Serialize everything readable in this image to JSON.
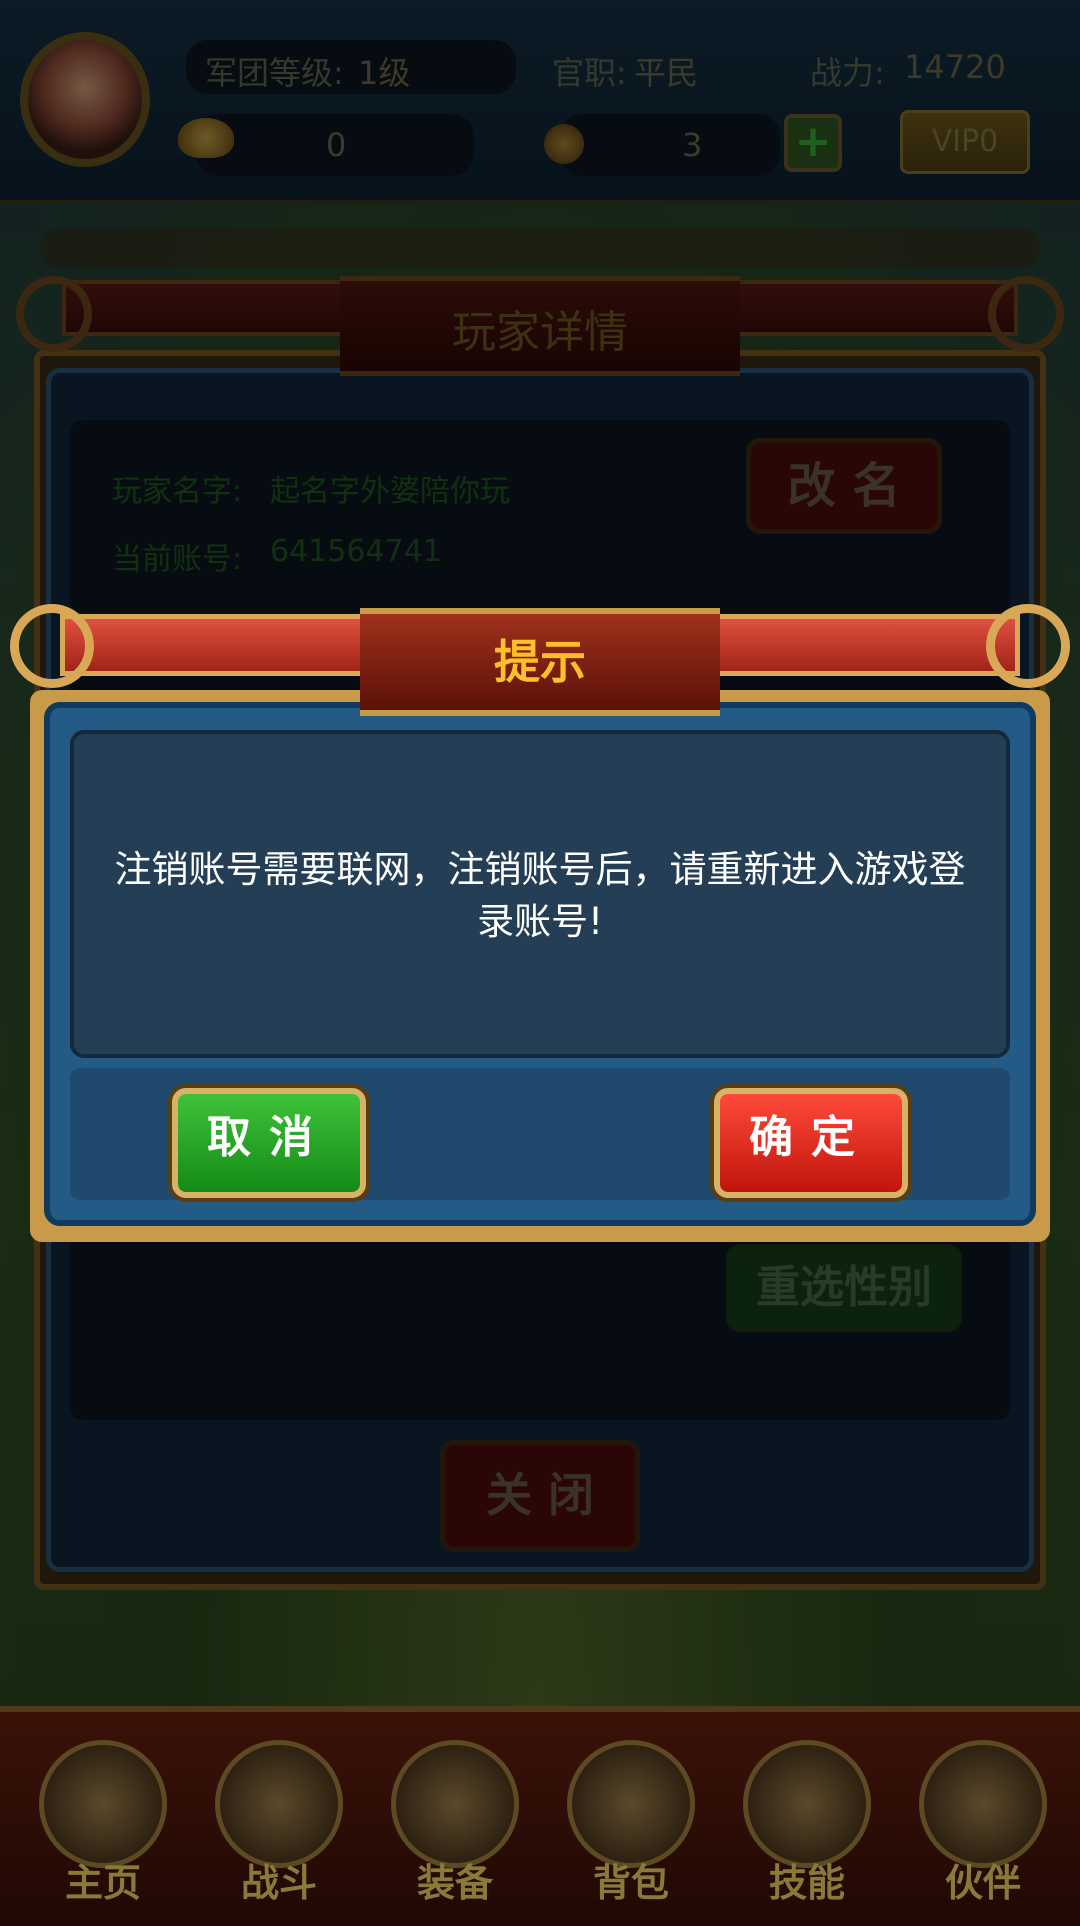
{
  "top_bar": {
    "legion_level_label": "军团等级:",
    "legion_level_value": "1级",
    "rank_label": "官职:",
    "rank_value": "平民",
    "power_label": "战力:",
    "power_value": "14720",
    "gold_value": "0",
    "coin_value": "3",
    "plus_symbol": "+",
    "vip_label": "VIP0"
  },
  "player_details": {
    "title": "玩家详情",
    "name_label": "玩家名字:",
    "name_value": "起名字外婆陪你玩",
    "account_label": "当前账号:",
    "account_value": "641564741",
    "rename_button": "改 名",
    "reselect_gender_button": "重选性别",
    "close_button": "关 闭"
  },
  "prompt_dialog": {
    "title": "提示",
    "message_line1": "注销账号需要联网，注销账号后，请重新进入游戏登",
    "message_line2": "录账号!",
    "cancel_button": "取消",
    "confirm_button": "确定"
  },
  "bottom_nav": {
    "items": [
      {
        "label": "主页",
        "icon": "home-emblem-icon"
      },
      {
        "label": "战斗",
        "icon": "crossed-swords-icon"
      },
      {
        "label": "装备",
        "icon": "helmet-icon"
      },
      {
        "label": "背包",
        "icon": "bag-icon"
      },
      {
        "label": "技能",
        "icon": "skill-scroll-icon"
      },
      {
        "label": "伙伴",
        "icon": "partner-warrior-icon"
      }
    ]
  },
  "colors": {
    "dialog_title": "#ffbf2a",
    "confirm_red": "#e8281c",
    "cancel_green": "#2aa82a",
    "panel_blue": "#245a86"
  }
}
